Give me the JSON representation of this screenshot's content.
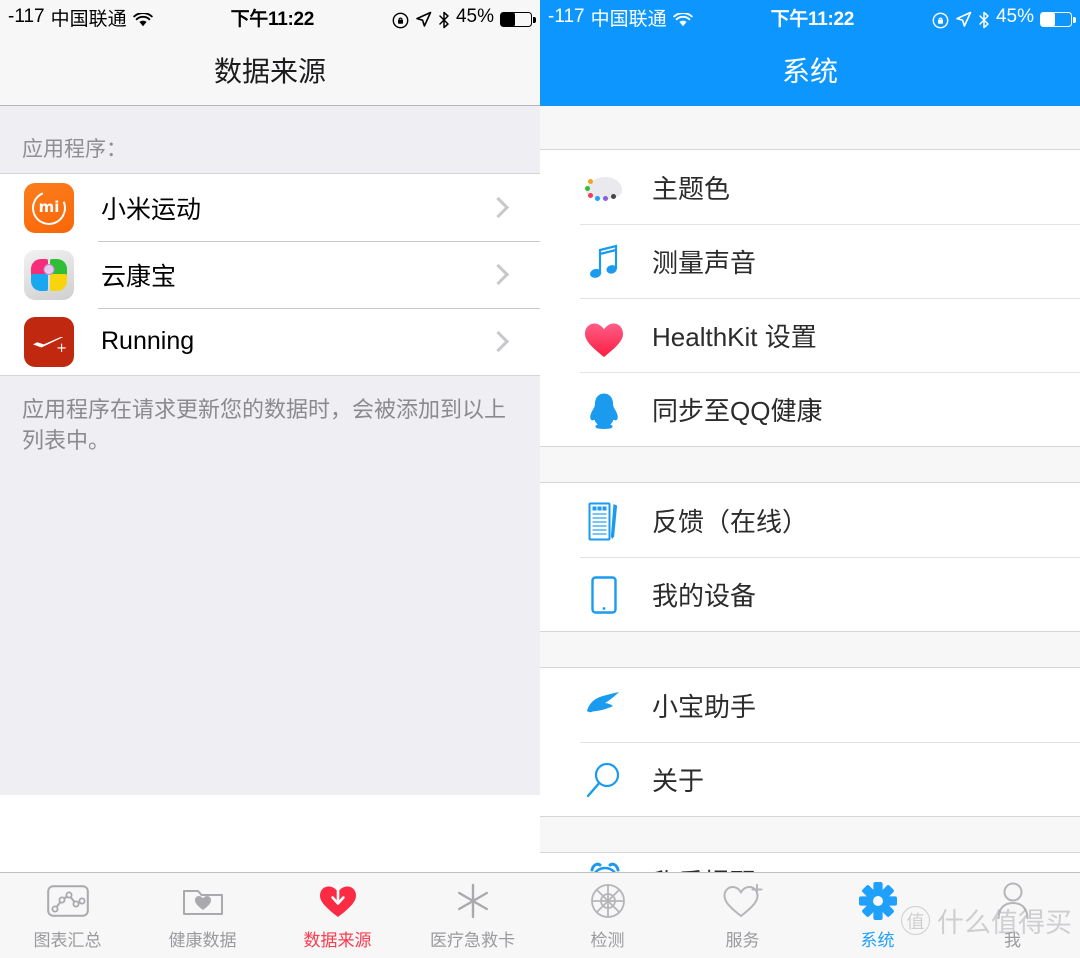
{
  "left": {
    "statusbar": {
      "signal": "-117",
      "carrier": "中国联通",
      "wifi_icon": "wifi-icon",
      "time": "下午11:22",
      "lock_icon": "rotation-lock-icon",
      "location_icon": "location-arrow-icon",
      "bluetooth_icon": "bluetooth-icon",
      "battery_pct": "45%",
      "battery_icon": "battery-icon"
    },
    "title": "数据来源",
    "section_label": "应用程序：",
    "apps": [
      {
        "name": "小米运动",
        "icon": "xiaomi-sport-icon",
        "chevron": "chevron-right-icon"
      },
      {
        "name": "云康宝",
        "icon": "yunkangbao-icon",
        "chevron": "chevron-right-icon"
      },
      {
        "name": "Running",
        "icon": "nike-running-icon",
        "chevron": "chevron-right-icon"
      }
    ],
    "footer_note": "应用程序在请求更新您的数据时，会被添加到以上列表中。",
    "tabs": [
      {
        "label": "图表汇总",
        "icon": "chart-summary-icon",
        "active": false
      },
      {
        "label": "健康数据",
        "icon": "health-data-folder-icon",
        "active": false
      },
      {
        "label": "数据来源",
        "icon": "data-source-heart-icon",
        "active": true
      },
      {
        "label": "医疗急救卡",
        "icon": "medical-id-icon",
        "active": false
      }
    ],
    "accent": "#fb3b4e"
  },
  "right": {
    "statusbar": {
      "signal": "-117",
      "carrier": "中国联通",
      "wifi_icon": "wifi-icon",
      "time": "下午11:22",
      "lock_icon": "rotation-lock-icon",
      "location_icon": "location-arrow-icon",
      "bluetooth_icon": "bluetooth-icon",
      "battery_pct": "45%",
      "battery_icon": "battery-icon"
    },
    "title": "系统",
    "header_color": "#0d96fd",
    "groups": [
      {
        "items": [
          {
            "label": "主题色",
            "icon": "palette-icon"
          },
          {
            "label": "测量声音",
            "icon": "music-note-icon"
          },
          {
            "label": "HealthKit  设置",
            "icon": "heart-icon"
          },
          {
            "label": "同步至QQ健康",
            "icon": "qq-penguin-icon"
          }
        ]
      },
      {
        "items": [
          {
            "label": "反馈（在线）",
            "icon": "feedback-document-icon"
          },
          {
            "label": "我的设备",
            "icon": "tablet-device-icon"
          }
        ]
      },
      {
        "items": [
          {
            "label": "小宝助手",
            "icon": "pointing-hand-icon"
          },
          {
            "label": "关于",
            "icon": "magnifier-icon"
          }
        ]
      },
      {
        "items": [
          {
            "label": "称重提醒",
            "icon": "alarm-clock-icon"
          }
        ]
      }
    ],
    "tabs": [
      {
        "label": "检测",
        "icon": "measure-target-icon",
        "active": false
      },
      {
        "label": "服务",
        "icon": "heart-plus-icon",
        "active": false
      },
      {
        "label": "系统",
        "icon": "gear-icon",
        "active": true
      },
      {
        "label": "我",
        "icon": "person-icon",
        "active": false
      }
    ],
    "accent": "#1fa0fb"
  },
  "watermark": {
    "mark": "值",
    "text": "什么值得买"
  }
}
